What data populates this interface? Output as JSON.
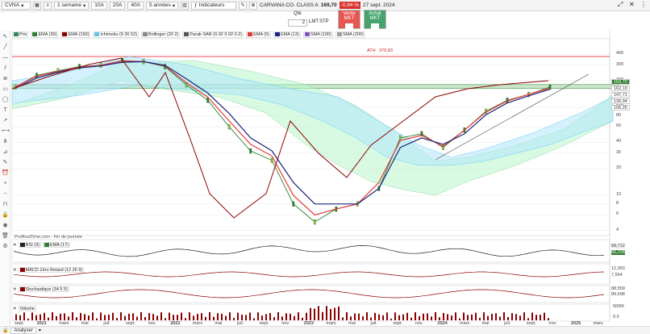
{
  "toolbar": {
    "ticker": "CVNA",
    "timeframe": "1 semaine",
    "ranges": [
      "10A",
      "20A",
      "40A"
    ],
    "period": "5 années",
    "indicators": "Indicateurs",
    "instrument": "CARVANA CO. CLASS A",
    "price": "169,70",
    "change": "-0,94 %",
    "date": "27 sept. 2024"
  },
  "order": {
    "qty_label": "Qté",
    "qty_value": "2",
    "lmt": "LMT",
    "stp": "STP",
    "sell": "Vente MKT",
    "buy": "Achat MKT"
  },
  "legend": [
    {
      "label": "Prix",
      "color": "#2e8b57"
    },
    {
      "label": "EMA (30)",
      "color": "#2e7d32"
    },
    {
      "label": "EMA (150)",
      "color": "#8b0000"
    },
    {
      "label": "Ichimoku (9 26 52)",
      "color": "#63c4e8"
    },
    {
      "label": "Bollinger (20 2)",
      "color": "#888888"
    },
    {
      "label": "Parab SAR (0.02 0.02 0.2)",
      "color": "#555555"
    },
    {
      "label": "EMA (5)",
      "color": "#e53935"
    },
    {
      "label": "EMA (13)",
      "color": "#1a237e"
    },
    {
      "label": "SMA (100)",
      "color": "#7e57c2"
    },
    {
      "label": "SMA (200)",
      "color": "#9e9e9e"
    }
  ],
  "ath": {
    "label": "ATH",
    "value": "376,83"
  },
  "y_axis": [
    "400",
    "300",
    "200",
    "100",
    "80",
    "60",
    "40",
    "30",
    "20",
    "10",
    "8",
    "6",
    "4"
  ],
  "price_tags": [
    {
      "value": "169,70",
      "bg": "#2e7d32",
      "fg": "#fff"
    },
    {
      "value": "162,10",
      "bg": "#ffffff",
      "fg": "#333"
    },
    {
      "value": "147,71",
      "bg": "#ffffff",
      "fg": "#333"
    },
    {
      "value": "136,94",
      "bg": "#ffffff",
      "fg": "#333"
    },
    {
      "value": "106,25",
      "bg": "#ffffff",
      "fg": "#333"
    }
  ],
  "source": "ProRealTime.com - Fin de journée",
  "rsi": {
    "label": "RSI (9)",
    "ema": "EMA (17)",
    "values": [
      "68,712",
      "66,228"
    ]
  },
  "macd": {
    "label": "MACD Zéro Retard (12 26 9)",
    "values": [
      "12,353",
      "7,564"
    ]
  },
  "stoch": {
    "label": "Stochastique (34 5 5)",
    "values": [
      "88,559",
      "89,698"
    ]
  },
  "volume": {
    "label": "Volume",
    "ticks": [
      "500M",
      "0.0"
    ]
  },
  "x_axis": [
    "sept.",
    "2021",
    "mars",
    "mai",
    "juil.",
    "sept.",
    "nov.",
    "2022",
    "mars",
    "mai",
    "juil.",
    "sept.",
    "nov.",
    "2023",
    "mars",
    "mai",
    "juil.",
    "sept.",
    "nov.",
    "2024",
    "mars",
    "mai",
    "juil.",
    "sept.",
    "nov.",
    "2025",
    "mars"
  ],
  "bottom": {
    "analyser": "Analyser"
  },
  "chart_data": {
    "type": "line",
    "title": "CARVANA CO. CLASS A",
    "ylabel": "",
    "y_scale": "log",
    "ylim": [
      3.5,
      600
    ],
    "x": [
      "2020-09",
      "2020-11",
      "2021-01",
      "2021-03",
      "2021-05",
      "2021-07",
      "2021-09",
      "2021-11",
      "2022-01",
      "2022-03",
      "2022-05",
      "2022-07",
      "2022-09",
      "2022-11",
      "2022-12",
      "2023-01",
      "2023-03",
      "2023-05",
      "2023-07",
      "2023-09",
      "2023-11",
      "2024-01",
      "2024-03",
      "2024-05",
      "2024-07",
      "2024-09"
    ],
    "series": [
      {
        "name": "Prix",
        "values": [
          170,
          230,
          260,
          290,
          300,
          340,
          330,
          290,
          180,
          120,
          60,
          32,
          25,
          8,
          5,
          7,
          8,
          12,
          45,
          50,
          35,
          55,
          90,
          120,
          140,
          170
        ]
      },
      {
        "name": "EMA (5)",
        "values": [
          170,
          225,
          255,
          285,
          300,
          335,
          330,
          295,
          190,
          130,
          70,
          38,
          28,
          10,
          6,
          7,
          8,
          14,
          42,
          48,
          36,
          55,
          88,
          118,
          140,
          165
        ]
      },
      {
        "name": "EMA (13)",
        "values": [
          165,
          215,
          250,
          280,
          295,
          325,
          330,
          300,
          210,
          145,
          85,
          45,
          32,
          14,
          8,
          8,
          8,
          12,
          35,
          45,
          38,
          50,
          82,
          112,
          135,
          160
        ]
      }
    ]
  }
}
